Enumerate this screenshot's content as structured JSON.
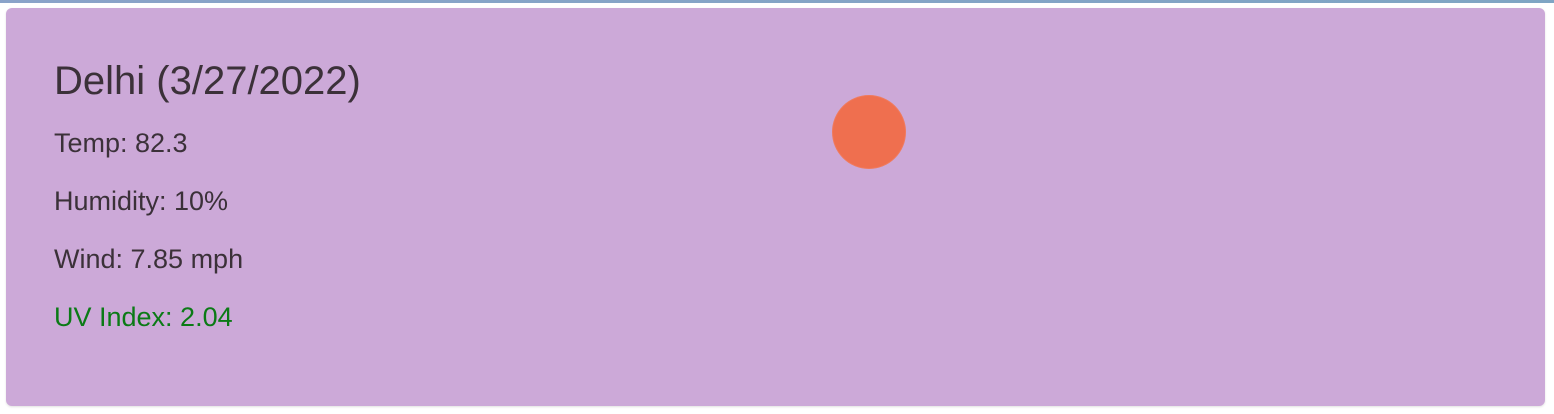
{
  "weather_card": {
    "city_date_title": "Delhi (3/27/2022)",
    "temperature": "Temp: 82.3",
    "humidity": "Humidity: 10%",
    "wind": "Wind: 7.85 mph",
    "uv_index": "UV Index: 2.04",
    "weather_icon": "sun-icon",
    "uv_index_color": "#0b7a16",
    "background_color": "#cca9d8",
    "icon_color": "#ef6f4f"
  }
}
